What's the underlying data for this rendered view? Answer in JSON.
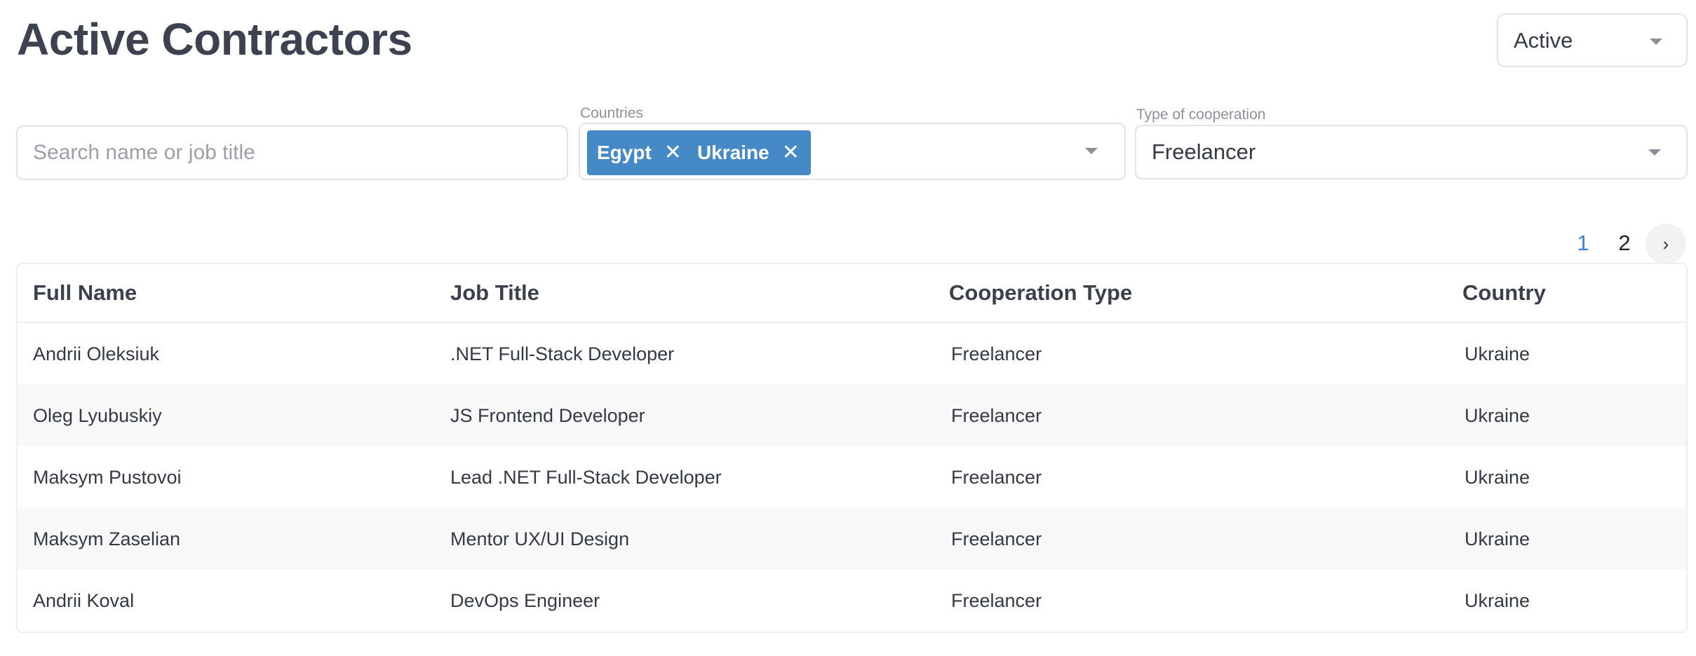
{
  "page": {
    "title": "Active Contractors"
  },
  "status_filter": {
    "value": "Active"
  },
  "filters": {
    "search": {
      "placeholder": "Search name or job title",
      "value": ""
    },
    "countries": {
      "label": "Countries",
      "selected": [
        "Egypt",
        "Ukraine"
      ]
    },
    "cooperation": {
      "label": "Type of cooperation",
      "value": "Freelancer"
    }
  },
  "pagination": {
    "pages": [
      "1",
      "2"
    ],
    "current": "1",
    "next_icon": "chevron-right-icon"
  },
  "table": {
    "columns": [
      "Full Name",
      "Job Title",
      "Cooperation Type",
      "Country"
    ],
    "rows": [
      [
        "Andrii Oleksiuk",
        ".NET Full-Stack Developer",
        "Freelancer",
        "Ukraine"
      ],
      [
        "Oleg Lyubuskiy",
        "JS Frontend Developer",
        "Freelancer",
        "Ukraine"
      ],
      [
        "Maksym Pustovoi",
        "Lead .NET Full-Stack Developer",
        "Freelancer",
        "Ukraine"
      ],
      [
        "Maksym Zaselian",
        "Mentor UX/UI Design",
        "Freelancer",
        "Ukraine"
      ],
      [
        "Andrii Koval",
        "DevOps Engineer",
        "Freelancer",
        "Ukraine"
      ]
    ]
  },
  "colors": {
    "accent": "#4589c6",
    "active_page": "#3b82d6",
    "text": "#333a45",
    "border": "#e2e4e8",
    "row_alt": "#f8f8f9"
  }
}
